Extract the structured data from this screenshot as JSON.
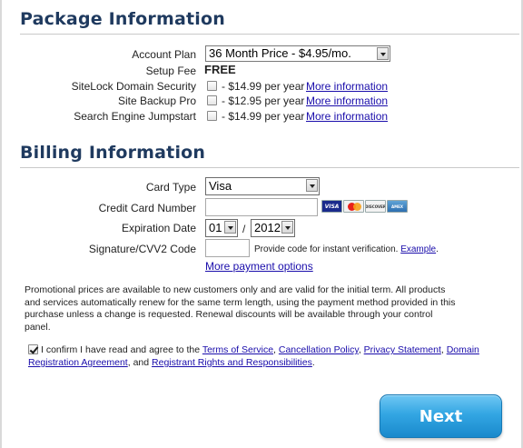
{
  "package": {
    "title": "Package Information",
    "account_plan_label": "Account Plan",
    "account_plan_value": "36 Month Price - $4.95/mo.",
    "setup_fee_label": "Setup Fee",
    "setup_fee_value": "FREE",
    "addons": [
      {
        "label": "SiteLock Domain Security",
        "checked": false,
        "price": "- $14.99 per year",
        "link": "More information"
      },
      {
        "label": "Site Backup Pro",
        "checked": false,
        "price": "- $12.95 per year",
        "link": "More information"
      },
      {
        "label": "Search Engine Jumpstart",
        "checked": false,
        "price": "- $14.99 per year",
        "link": "More information"
      }
    ]
  },
  "billing": {
    "title": "Billing Information",
    "card_type_label": "Card Type",
    "card_type_value": "Visa",
    "card_number_label": "Credit Card Number",
    "card_number_value": "",
    "card_logos": [
      "VISA",
      "MasterCard",
      "DISCOVER",
      "AMEX"
    ],
    "expiration_label": "Expiration Date",
    "expiration_month": "01",
    "expiration_separator": "/",
    "expiration_year": "2012",
    "cvv_label": "Signature/CVV2 Code",
    "cvv_value": "",
    "cvv_hint": "Provide code for instant verification.",
    "cvv_example_link": "Example",
    "more_payment_link": "More payment options"
  },
  "promo_note": "Promotional prices are available to new customers only and are valid for the initial term. All products and services automatically renew for the same term length, using the payment method provided in this purchase unless a change is requested. Renewal discounts will be available through your control panel.",
  "confirm": {
    "checked": true,
    "prefix": "I confirm I have read and agree to the ",
    "terms_link": "Terms of Service",
    "sep1": ", ",
    "cancel_link": "Cancellation Policy",
    "sep2": ", ",
    "privacy_link": "Privacy Statement",
    "sep3": ", ",
    "domain_link": "Domain Registration Agreement",
    "sep4": ", and ",
    "registrant_link": "Registrant Rights and Responsibilities",
    "suffix": "."
  },
  "next_button": "Next",
  "colors": {
    "heading": "#1f3a5f",
    "link": "#1a0dab",
    "button": "#33a6e3"
  }
}
